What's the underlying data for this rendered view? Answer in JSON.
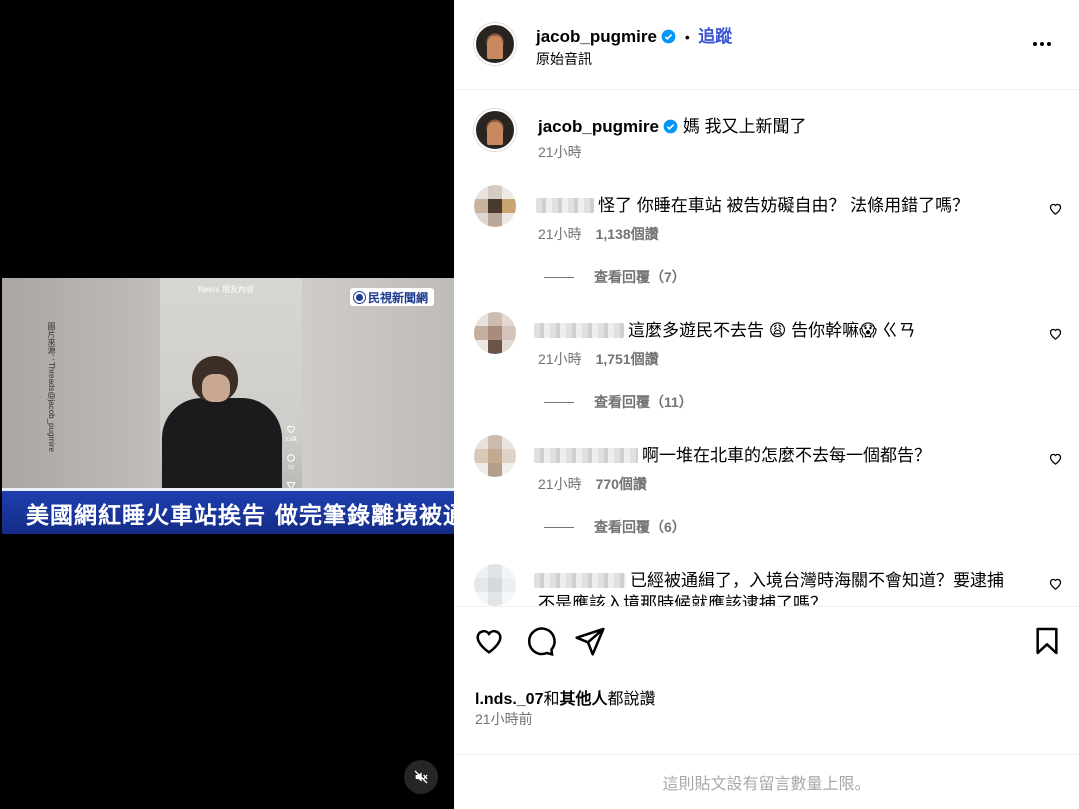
{
  "media": {
    "reel_label": "Reels  朋友內容",
    "side_watermark": "圖片來源：Threads@jacob_pugmire",
    "news_logo": "民視新聞網",
    "headline": "美國網紅睡火車站挨告 做完筆錄離境被通緝",
    "reel_counts": [
      "3.9萬",
      "53",
      ""
    ]
  },
  "header": {
    "username": "jacob_pugmire",
    "separator": "•",
    "follow_label": "追蹤",
    "audio": "原始音訊"
  },
  "caption": {
    "username": "jacob_pugmire",
    "text": "媽 我又上新聞了",
    "time": "21小時"
  },
  "comments": [
    {
      "text": "怪了 你睡在車站 被告妨礙自由？ 法條用錯了嗎？",
      "time": "21小時",
      "likes": "1,138個讚",
      "replies": "查看回覆（7）"
    },
    {
      "text": "這麼多遊民不去告 😩 告你幹嘛😱 ㄍㄢ",
      "time": "21小時",
      "likes": "1,751個讚",
      "replies": "查看回覆（11）"
    },
    {
      "text": "啊一堆在北車的怎麼不去每一個都告？",
      "time": "21小時",
      "likes": "770個讚",
      "replies": "查看回覆（6）"
    },
    {
      "text": "已經被通緝了，入境台灣時海關不會知道？要逮捕",
      "text2": "不是應該入境那時候就應該逮捕了嗎？"
    }
  ],
  "actions": {
    "likes_user": "l.nds._07",
    "likes_and": "和",
    "likes_others": "其他人",
    "likes_suffix": "都說讚",
    "time": "21小時前"
  },
  "footer": {
    "limit_notice": "這則貼文設有留言數量上限。"
  },
  "icons": [
    "heart-icon",
    "comment-icon",
    "share-icon",
    "bookmark-icon",
    "more-icon",
    "mute-icon",
    "verified-icon"
  ]
}
